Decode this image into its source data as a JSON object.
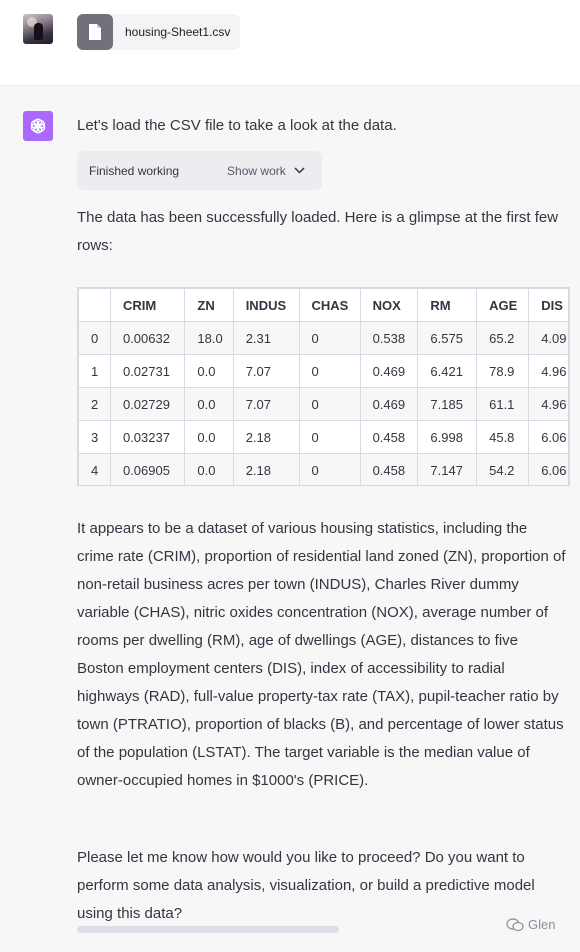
{
  "user_message": {
    "attachment": {
      "file_name": "housing-Sheet1.csv",
      "icon": "file-icon"
    }
  },
  "assistant": {
    "intro": "Let's load the CSV file to take a look at the data.",
    "work_status": {
      "label": "Finished working",
      "toggle_label": "Show work"
    },
    "loaded_text": "The data has been successfully loaded. Here is a glimpse at the first few rows:",
    "table": {
      "columns": [
        "",
        "CRIM",
        "ZN",
        "INDUS",
        "CHAS",
        "NOX",
        "RM",
        "AGE",
        "DIS"
      ],
      "rows": [
        [
          "0",
          "0.00632",
          "18.0",
          "2.31",
          "0",
          "0.538",
          "6.575",
          "65.2",
          "4.09"
        ],
        [
          "1",
          "0.02731",
          "0.0",
          "7.07",
          "0",
          "0.469",
          "6.421",
          "78.9",
          "4.96"
        ],
        [
          "2",
          "0.02729",
          "0.0",
          "7.07",
          "0",
          "0.469",
          "7.185",
          "61.1",
          "4.96"
        ],
        [
          "3",
          "0.03237",
          "0.0",
          "2.18",
          "0",
          "0.458",
          "6.998",
          "45.8",
          "6.06"
        ],
        [
          "4",
          "0.06905",
          "0.0",
          "2.18",
          "0",
          "0.458",
          "7.147",
          "54.2",
          "6.06"
        ]
      ]
    },
    "description": "It appears to be a dataset of various housing statistics, including the crime rate (CRIM), proportion of residential land zoned (ZN), proportion of non-retail business acres per town (INDUS), Charles River dummy variable (CHAS), nitric oxides concentration (NOX), average number of rooms per dwelling (RM), age of dwellings (AGE), distances to five Boston employment centers (DIS), index of accessibility to radial highways (RAD), full-value property-tax rate (TAX), pupil-teacher ratio by town (PTRATIO), proportion of blacks (B), and percentage of lower status of the population (LSTAT). The target variable is the median value of owner-occupied homes in $1000's (PRICE).",
    "followup": "Please let me know how would you like to proceed? Do you want to perform some data analysis, visualization, or build a predictive model using this data?"
  },
  "watermark": {
    "text": "Glen",
    "icon": "wechat-icon"
  },
  "colors": {
    "accent": "#ab68ff",
    "file_icon_bg": "#70717b",
    "background": "#f7f7f8"
  }
}
